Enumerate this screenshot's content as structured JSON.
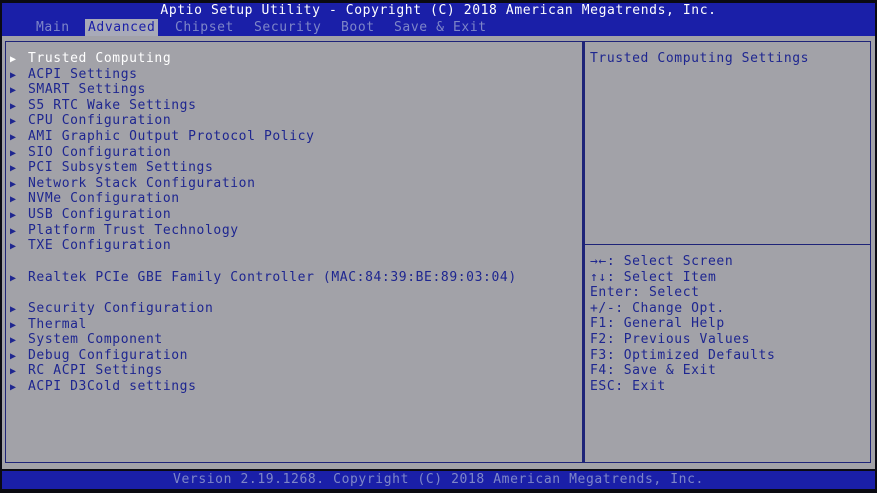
{
  "title": "Aptio Setup Utility - Copyright (C) 2018 American Megatrends, Inc.",
  "tabs": [
    {
      "label": "Main"
    },
    {
      "label": "Advanced"
    },
    {
      "label": "Chipset"
    },
    {
      "label": "Security"
    },
    {
      "label": "Boot"
    },
    {
      "label": "Save & Exit"
    }
  ],
  "active_tab": "Advanced",
  "menu": {
    "arrow": "▶",
    "items": [
      {
        "label": "Trusted Computing"
      },
      {
        "label": "ACPI Settings"
      },
      {
        "label": "SMART Settings"
      },
      {
        "label": "S5 RTC Wake Settings"
      },
      {
        "label": "CPU Configuration"
      },
      {
        "label": "AMI Graphic Output Protocol Policy"
      },
      {
        "label": "SIO Configuration"
      },
      {
        "label": "PCI Subsystem Settings"
      },
      {
        "label": "Network Stack Configuration"
      },
      {
        "label": "NVMe Configuration"
      },
      {
        "label": "USB Configuration"
      },
      {
        "label": "Platform Trust Technology"
      },
      {
        "label": "TXE Configuration"
      },
      {
        "label": "Realtek PCIe GBE Family Controller (MAC:84:39:BE:89:03:04)"
      },
      {
        "label": "Security Configuration"
      },
      {
        "label": "Thermal"
      },
      {
        "label": "System Component"
      },
      {
        "label": "Debug Configuration"
      },
      {
        "label": "RC ACPI Settings"
      },
      {
        "label": "ACPI D3Cold settings"
      }
    ],
    "selected_index": 0
  },
  "help": {
    "description": "Trusted Computing Settings",
    "keys": [
      {
        "key": "→←",
        "action": ": Select Screen"
      },
      {
        "key": "↑↓",
        "action": ": Select Item"
      },
      {
        "key": "Enter",
        "action": ": Select"
      },
      {
        "key": "+/-",
        "action": ": Change Opt."
      },
      {
        "key": "F1",
        "action": ": General Help"
      },
      {
        "key": "F2",
        "action": ": Previous Values"
      },
      {
        "key": "F3",
        "action": ": Optimized Defaults"
      },
      {
        "key": "F4",
        "action": ": Save & Exit"
      },
      {
        "key": "ESC",
        "action": ": Exit"
      }
    ]
  },
  "footer": "Version 2.19.1268. Copyright (C) 2018 American Megatrends, Inc.",
  "colors": {
    "header_blue": "#1a1fa8",
    "panel_gray": "#a2a2a8",
    "text_blue": "#1e2690",
    "selected_text": "#ffffff",
    "inactive_tab_text": "#7e86c8"
  }
}
